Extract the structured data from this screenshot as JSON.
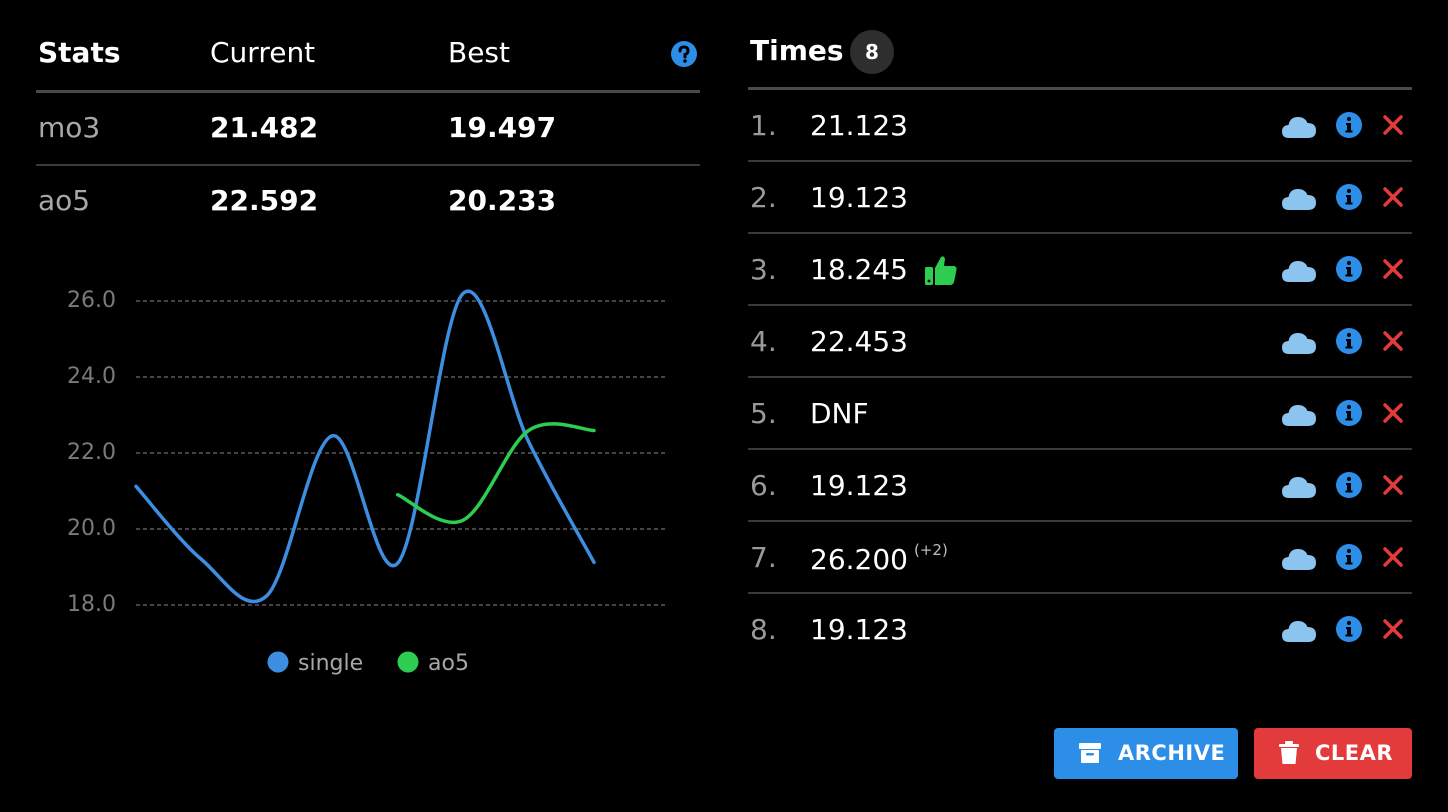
{
  "stats": {
    "headers": [
      "Stats",
      "Current",
      "Best"
    ],
    "rows": [
      {
        "label": "mo3",
        "current": "21.482",
        "best": "19.497"
      },
      {
        "label": "ao5",
        "current": "22.592",
        "best": "20.233"
      }
    ]
  },
  "chart_data": {
    "type": "line",
    "x": [
      1,
      2,
      3,
      4,
      5,
      6,
      7,
      8
    ],
    "series": [
      {
        "name": "single",
        "color": "#3d8ee0",
        "values": [
          21.123,
          19.2,
          18.245,
          22.453,
          19.1,
          26.2,
          22.3,
          19.123
        ]
      },
      {
        "name": "ao5",
        "color": "#2ecc50",
        "values": [
          null,
          null,
          null,
          null,
          20.9,
          20.233,
          22.592,
          22.592
        ]
      }
    ],
    "yticks": [
      "26.0",
      "24.0",
      "22.0",
      "20.0",
      "18.0"
    ],
    "ylim": [
      18,
      26
    ],
    "grid": true,
    "legend": "bottom"
  },
  "times": {
    "title": "Times",
    "count": "8",
    "items": [
      {
        "index": "1.",
        "value": "21.123",
        "penalty": "",
        "thumb": false
      },
      {
        "index": "2.",
        "value": "19.123",
        "penalty": "",
        "thumb": false
      },
      {
        "index": "3.",
        "value": "18.245",
        "penalty": "",
        "thumb": true
      },
      {
        "index": "4.",
        "value": "22.453",
        "penalty": "",
        "thumb": false
      },
      {
        "index": "5.",
        "value": "DNF",
        "penalty": "",
        "thumb": false
      },
      {
        "index": "6.",
        "value": "19.123",
        "penalty": "",
        "thumb": false
      },
      {
        "index": "7.",
        "value": "26.200",
        "penalty": "(+2)",
        "thumb": false
      },
      {
        "index": "8.",
        "value": "19.123",
        "penalty": "",
        "thumb": false
      }
    ]
  },
  "buttons": {
    "archive": "ARCHIVE",
    "clear": "CLEAR"
  },
  "icons": [
    "help-icon",
    "cloud-icon",
    "info-icon",
    "delete-icon",
    "thumbs-up-icon",
    "archive-icon",
    "trash-icon"
  ],
  "colors": {
    "accent": "#2d8ee8",
    "danger": "#e33b3b",
    "success": "#2ecc50",
    "cloud": "#8cc4f0"
  }
}
